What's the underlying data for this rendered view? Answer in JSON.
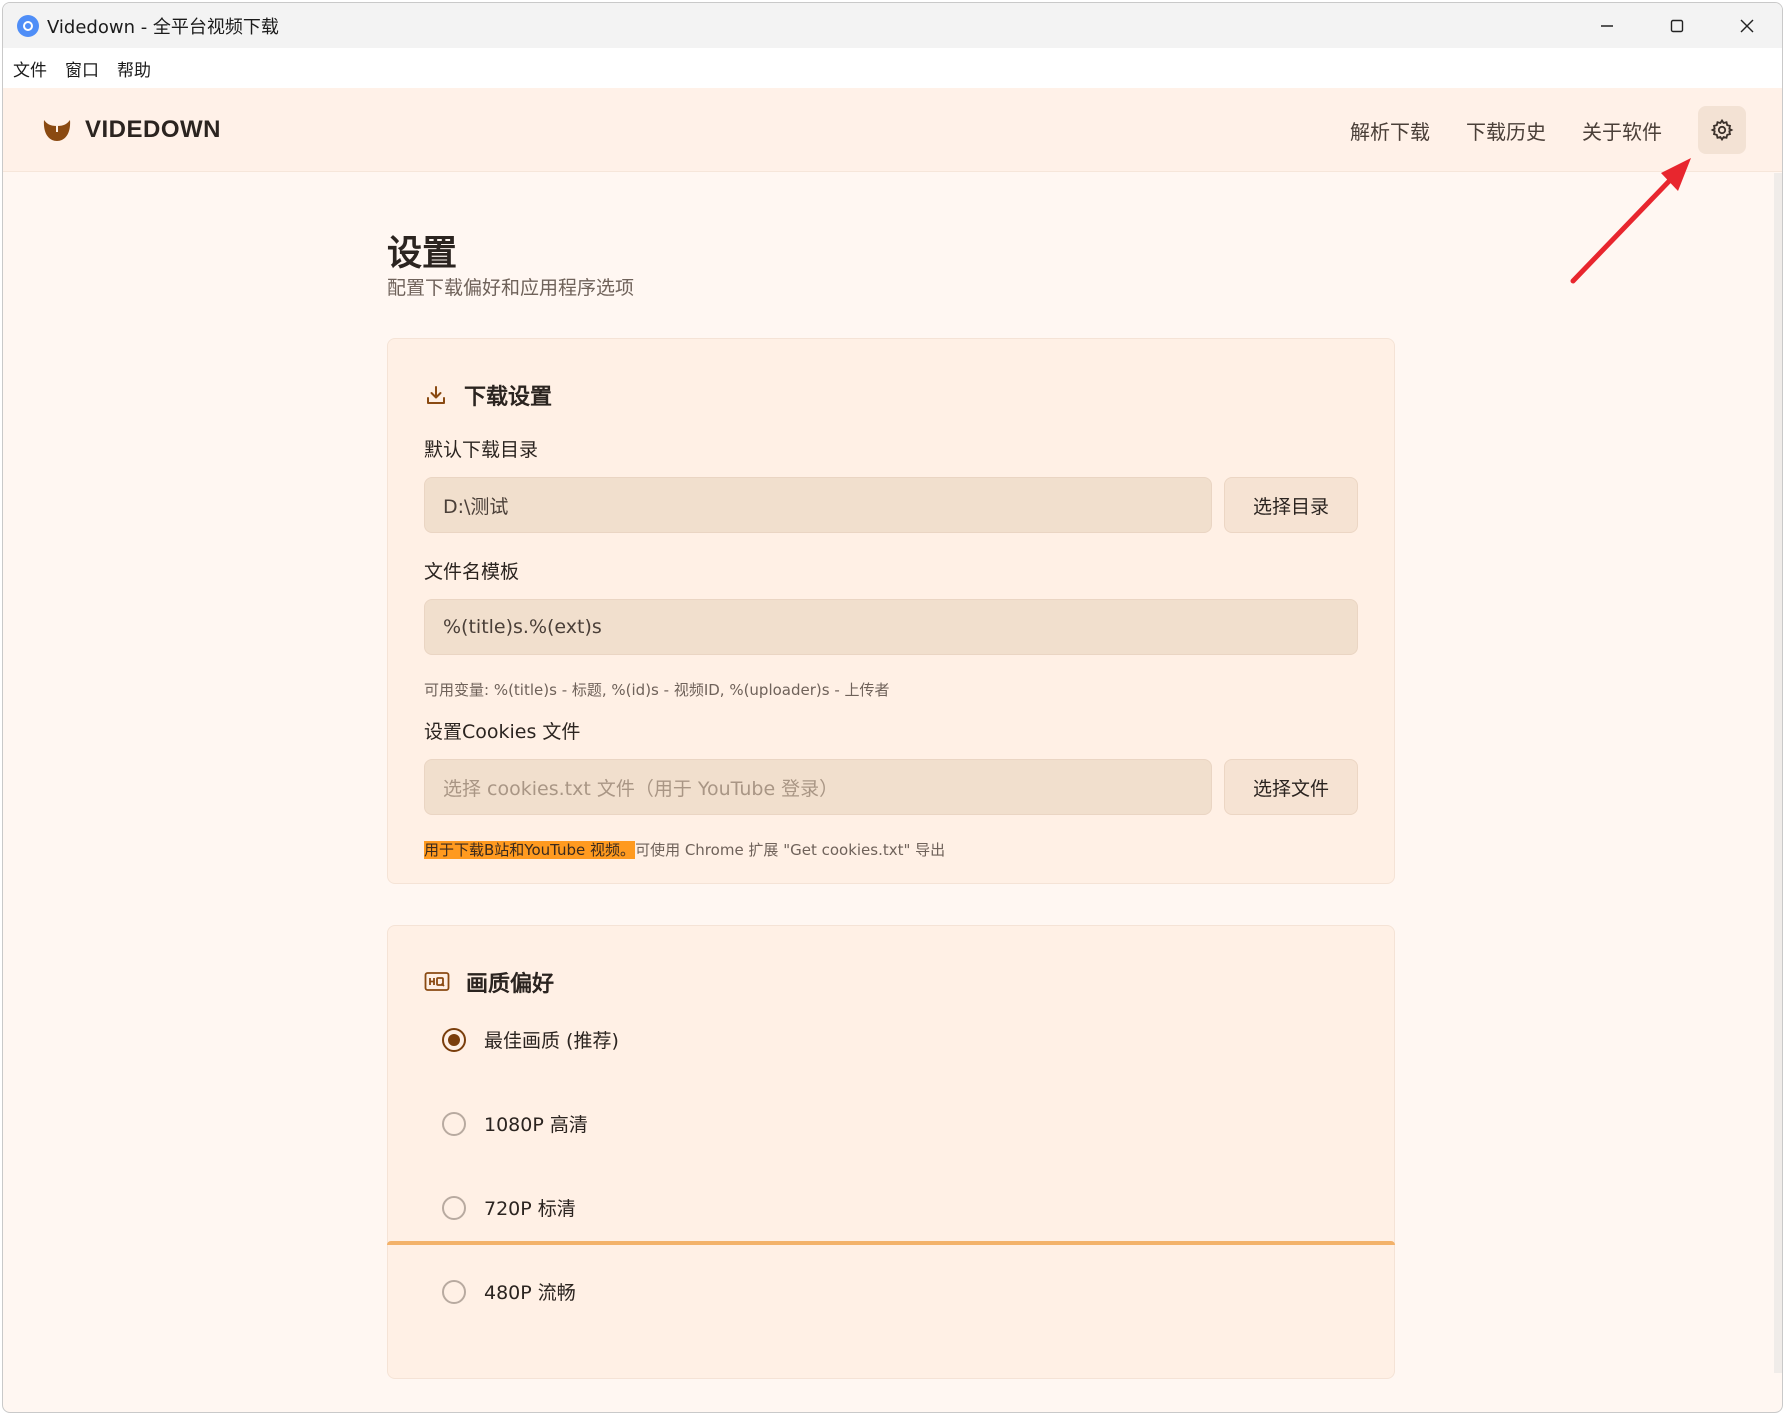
{
  "window": {
    "title": "Videdown - 全平台视频下载",
    "minimize_glyph": "—",
    "maximize_glyph": "☐",
    "close_glyph": "✕"
  },
  "menu": {
    "items": [
      "文件",
      "窗口",
      "帮助"
    ]
  },
  "header": {
    "logo_text": "VIDEDOWN",
    "nav": [
      "解析下载",
      "下载历史",
      "关于软件"
    ],
    "settings_icon": "gear-icon"
  },
  "page": {
    "title": "设置",
    "subtitle": "配置下载偏好和应用程序选项"
  },
  "download_settings": {
    "title": "下载设置",
    "icon": "download-icon",
    "dir_label": "默认下载目录",
    "dir_value": "D:\\测试",
    "dir_button": "选择目录",
    "template_label": "文件名模板",
    "template_value": "%(title)s.%(ext)s",
    "template_hint": "可用变量: %(title)s - 标题, %(id)s - 视频ID, %(uploader)s - 上传者",
    "cookies_label": "设置Cookies 文件",
    "cookies_placeholder": "选择 cookies.txt 文件（用于 YouTube 登录）",
    "cookies_button": "选择文件",
    "cookies_hint_highlight": "用于下载B站和YouTube 视频。",
    "cookies_hint_rest": "可使用 Chrome 扩展 \"Get cookies.txt\" 导出"
  },
  "quality": {
    "title": "画质偏好",
    "icon": "hq-icon",
    "options": [
      {
        "label": "最佳画质 (推荐)",
        "checked": true
      },
      {
        "label": "1080P 高清",
        "checked": false
      },
      {
        "label": "720P 标清",
        "checked": false
      },
      {
        "label": "480P 流畅",
        "checked": false
      }
    ]
  },
  "colors": {
    "accent": "#7a3e0c",
    "annotation_arrow": "#e8262e",
    "highlight": "#ff9a1f"
  }
}
